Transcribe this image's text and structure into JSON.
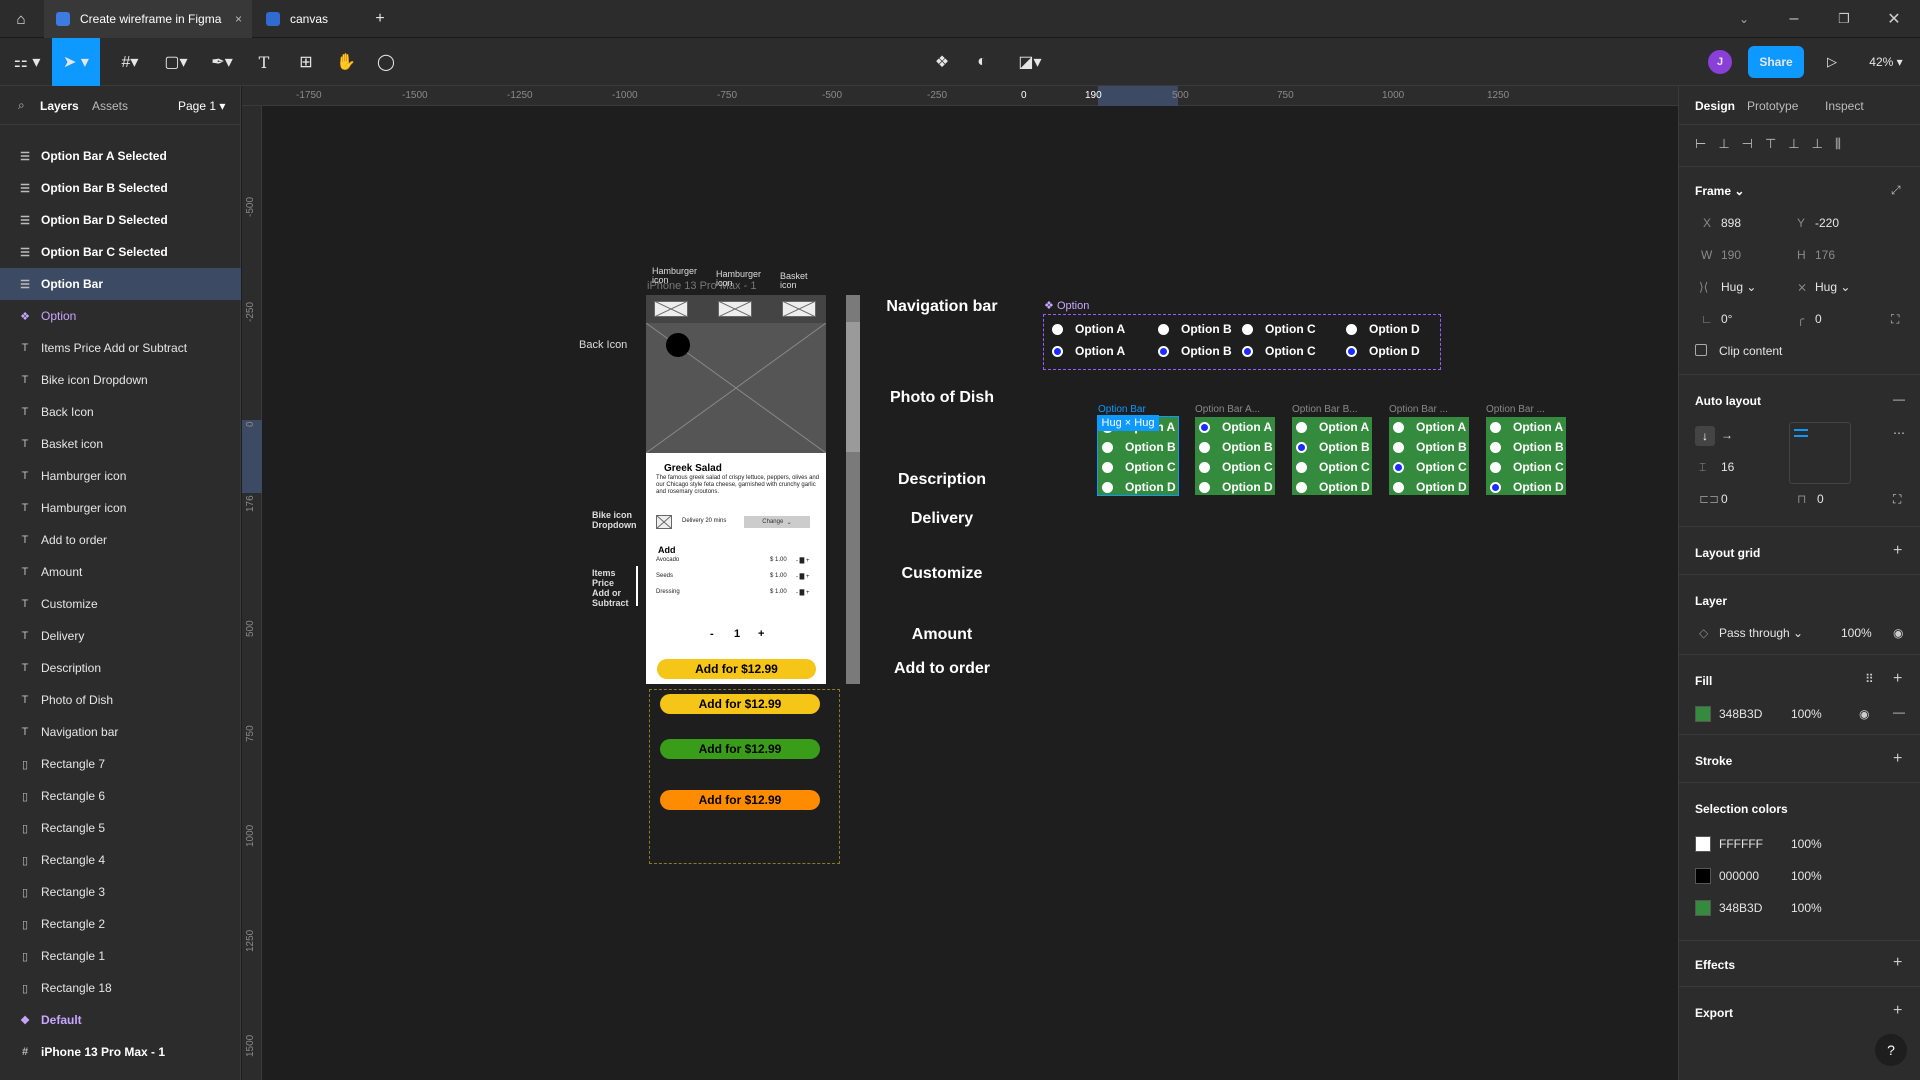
{
  "tabs": {
    "active": "Create wireframe in Figma",
    "second": "canvas"
  },
  "toolbar": {
    "avatar_letter": "J",
    "share": "Share",
    "zoom": "42%"
  },
  "left_panel": {
    "tab_layers": "Layers",
    "tab_assets": "Assets",
    "page": "Page 1",
    "layers": [
      {
        "label": "Option Bar A Selected",
        "icon": "auto-layout-icon",
        "style": "bold"
      },
      {
        "label": "Option Bar B Selected",
        "icon": "auto-layout-icon",
        "style": "bold"
      },
      {
        "label": "Option Bar D Selected",
        "icon": "auto-layout-icon",
        "style": "bold"
      },
      {
        "label": "Option Bar C Selected",
        "icon": "auto-layout-icon",
        "style": "bold"
      },
      {
        "label": "Option Bar",
        "icon": "auto-layout-icon",
        "style": "bold-selected"
      },
      {
        "label": "Option",
        "icon": "component-icon",
        "style": "component"
      },
      {
        "label": "Items Price Add or Subtract",
        "icon": "text-icon",
        "style": ""
      },
      {
        "label": "Bike icon Dropdown",
        "icon": "text-icon",
        "style": ""
      },
      {
        "label": "Back Icon",
        "icon": "text-icon",
        "style": ""
      },
      {
        "label": "Basket icon",
        "icon": "text-icon",
        "style": ""
      },
      {
        "label": "Hamburger icon",
        "icon": "text-icon",
        "style": ""
      },
      {
        "label": "Hamburger icon",
        "icon": "text-icon",
        "style": ""
      },
      {
        "label": "Add to order",
        "icon": "text-icon",
        "style": ""
      },
      {
        "label": "Amount",
        "icon": "text-icon",
        "style": ""
      },
      {
        "label": "Customize",
        "icon": "text-icon",
        "style": ""
      },
      {
        "label": "Delivery",
        "icon": "text-icon",
        "style": ""
      },
      {
        "label": "Description",
        "icon": "text-icon",
        "style": ""
      },
      {
        "label": "Photo of Dish",
        "icon": "text-icon",
        "style": ""
      },
      {
        "label": "Navigation bar",
        "icon": "text-icon",
        "style": ""
      },
      {
        "label": "Rectangle 7",
        "icon": "rectangle-icon",
        "style": ""
      },
      {
        "label": "Rectangle 6",
        "icon": "rectangle-icon",
        "style": ""
      },
      {
        "label": "Rectangle 5",
        "icon": "rectangle-icon",
        "style": ""
      },
      {
        "label": "Rectangle 4",
        "icon": "rectangle-icon",
        "style": ""
      },
      {
        "label": "Rectangle 3",
        "icon": "rectangle-icon",
        "style": ""
      },
      {
        "label": "Rectangle 2",
        "icon": "rectangle-icon",
        "style": ""
      },
      {
        "label": "Rectangle 1",
        "icon": "rectangle-icon",
        "style": ""
      },
      {
        "label": "Rectangle 18",
        "icon": "rectangle-icon",
        "style": ""
      },
      {
        "label": "Default",
        "icon": "component-icon",
        "style": "component-bold"
      },
      {
        "label": "iPhone 13 Pro Max - 1",
        "icon": "frame-icon",
        "style": "bold"
      }
    ]
  },
  "ruler": {
    "top": [
      "-1750",
      "-1500",
      "-1250",
      "-1000",
      "-750",
      "-500",
      "-250",
      "0",
      "190",
      "500",
      "750",
      "1000",
      "1250"
    ],
    "left": [
      "-500",
      "-250",
      "0",
      "176",
      "500",
      "750",
      "1000",
      "1250",
      "1500"
    ]
  },
  "canvas": {
    "frame_name": "iPhone 13 Pro Max - 1",
    "hamburger1": "Hamburger icon",
    "hamburger2": "Hamburger icon",
    "basket": "Basket icon",
    "back_icon": "Back Icon",
    "bike_icon": "Bike icon Dropdown",
    "items_price": "Items Price Add or Subtract",
    "dish_title": "Greek Salad",
    "dish_desc": "The famous greek salad of crispy lettuce, peppers, olives and our Chicago style feta cheese, garnished with crunchy garlic and rosemary croutons.",
    "delivery": "Delivery 20 mins",
    "change": "Change",
    "add_heading": "Add",
    "addons": [
      {
        "name": "Avocado",
        "price": "$ 1.00"
      },
      {
        "name": "Seeds",
        "price": "$ 1.00"
      },
      {
        "name": "Dressing",
        "price": "$ 1.00"
      }
    ],
    "qty_minus": "-",
    "qty": "1",
    "qty_plus": "+",
    "add_btn": "Add for $12.99",
    "variants": [
      "Add for $12.99",
      "Add for $12.99",
      "Add for $12.99"
    ],
    "labels": {
      "nav": "Navigation bar",
      "photo": "Photo of Dish",
      "desc": "Description",
      "delivery": "Delivery",
      "customize": "Customize",
      "amount": "Amount",
      "add": "Add to order"
    },
    "option_component": "Option",
    "option_pairs": [
      {
        "label": "Option A"
      },
      {
        "label": "Option B"
      },
      {
        "label": "Option C"
      },
      {
        "label": "Option D"
      }
    ],
    "bars": [
      {
        "title": "Option Bar",
        "selected_index": -1
      },
      {
        "title": "Option Bar A...",
        "selected_index": 0
      },
      {
        "title": "Option Bar B...",
        "selected_index": 1
      },
      {
        "title": "Option Bar ...",
        "selected_index": 2
      },
      {
        "title": "Option Bar ...",
        "selected_index": 3
      }
    ],
    "bar_options": [
      "Option A",
      "Option B",
      "Option C",
      "Option D"
    ],
    "hug_badge": "Hug × Hug"
  },
  "right_panel": {
    "tab_design": "Design",
    "tab_prototype": "Prototype",
    "tab_inspect": "Inspect",
    "frame": "Frame",
    "x_label": "X",
    "x": "898",
    "y_label": "Y",
    "y": "-220",
    "w_label": "W",
    "w": "190",
    "h_label": "H",
    "h": "176",
    "hug_w": "Hug",
    "hug_h": "Hug",
    "rotation": "0°",
    "radius": "0",
    "clip": "Clip content",
    "auto_layout": "Auto layout",
    "spacing": "16",
    "pad_h": "0",
    "pad_v": "0",
    "layout_grid": "Layout grid",
    "layer": "Layer",
    "blend": "Pass through",
    "layer_opacity": "100%",
    "fill": "Fill",
    "fill_hex": "348B3D",
    "fill_opacity": "100%",
    "stroke": "Stroke",
    "selection_colors": "Selection colors",
    "colors": [
      {
        "hex": "FFFFFF",
        "opacity": "100%",
        "color": "#FFFFFF"
      },
      {
        "hex": "000000",
        "opacity": "100%",
        "color": "#000000"
      },
      {
        "hex": "348B3D",
        "opacity": "100%",
        "color": "#348B3D"
      }
    ],
    "effects": "Effects",
    "export": "Export",
    "help": "?"
  },
  "colors": {
    "accent": "#0d99ff",
    "selection": "#3d4a63",
    "option_green": "#348b3d",
    "yellow_btn": "#f5c518",
    "green_btn": "#3a9d1a",
    "orange_btn": "#ff8c00"
  }
}
